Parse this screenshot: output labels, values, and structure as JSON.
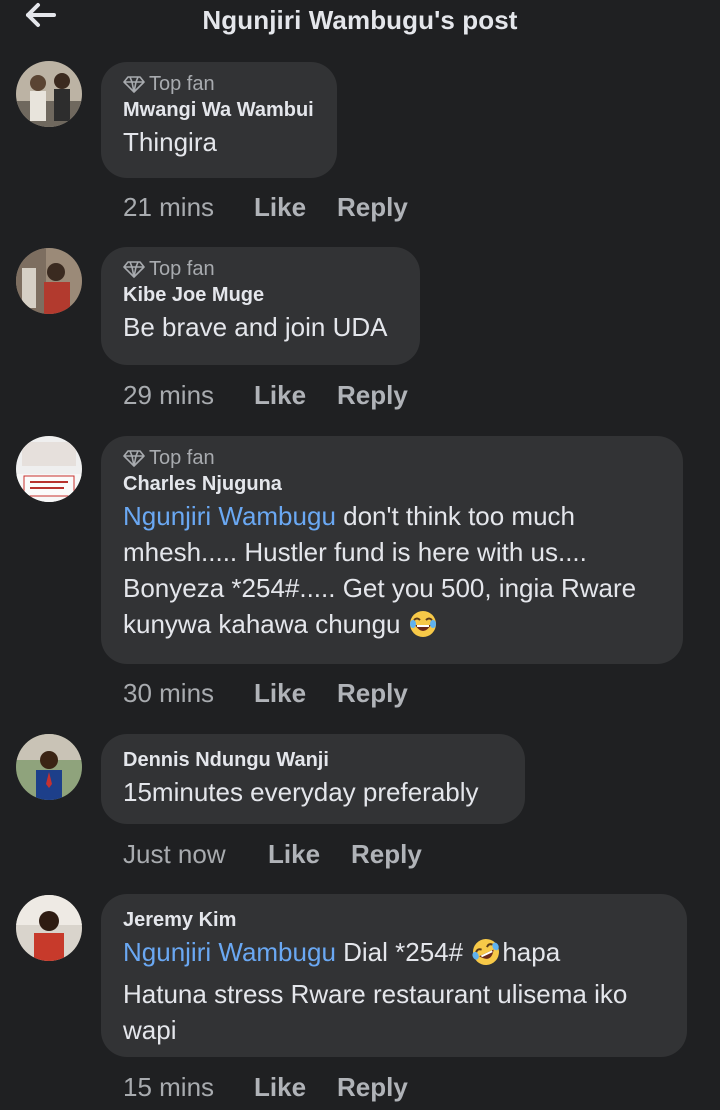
{
  "header": {
    "title": "Ngunjiri Wambugu's post",
    "back_icon": "back-arrow-icon"
  },
  "labels": {
    "top_fan": "Top fan",
    "like": "Like",
    "reply": "Reply"
  },
  "comments": [
    {
      "name": "Mwangi Wa Wambui",
      "top_fan": true,
      "text": "Thingira",
      "time": "21 mins"
    },
    {
      "name": "Kibe Joe Muge",
      "top_fan": true,
      "text": "Be brave and join UDA",
      "time": "29 mins"
    },
    {
      "name": "Charles Njuguna",
      "top_fan": true,
      "mention": "Ngunjiri Wambugu",
      "text_lines": [
        " don't think too much",
        "mhesh..... Hustler fund is here with us....",
        "Bonyeza *254#..... Get you 500, ingia Rware",
        "kunywa kahawa chungu "
      ],
      "emoji": "face-with-tears-of-joy",
      "time": "30 mins"
    },
    {
      "name": "Dennis Ndungu Wanji",
      "top_fan": false,
      "text": "15minutes everyday preferably",
      "time": "Just now"
    },
    {
      "name": "Jeremy Kim",
      "top_fan": false,
      "mention": "Ngunjiri Wambugu",
      "text_lines": [
        "  Dial *254# ",
        "hapa",
        "Hatuna stress Rware restaurant ulisema iko",
        "wapi"
      ],
      "emoji": "rolling-on-the-floor-laughing",
      "time": "15 mins"
    }
  ],
  "colors": {
    "background": "#1f2022",
    "bubble": "#323335",
    "mention": "#6aa8f3",
    "meta": "#a8abaf",
    "text": "#e4e6eb"
  }
}
